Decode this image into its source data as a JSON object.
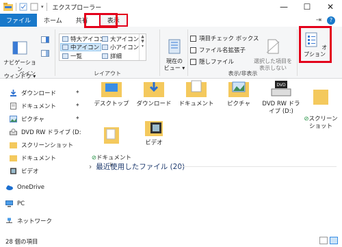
{
  "window": {
    "title": "エクスプローラー",
    "controls": {
      "minimize": "—",
      "maximize": "☐",
      "close": "✕"
    }
  },
  "tabs": {
    "file": "ファイル",
    "home": "ホーム",
    "share": "共有",
    "view": "表示",
    "expand_icon": "chevron-down-icon"
  },
  "ribbon": {
    "pane_group": {
      "label": "ペイン",
      "nav_pane": "ナビゲーション\nウィンドウ ▾"
    },
    "layout_group": {
      "label": "レイアウト",
      "items": [
        "特大アイコン",
        "大アイコン",
        "中アイコン",
        "小アイコン",
        "一覧",
        "詳細"
      ],
      "selected": "中アイコン"
    },
    "current_view": {
      "label": "現在の\nビュー ▾"
    },
    "showhide_group": {
      "label": "表示/非表示",
      "checks": [
        "項目チェック ボックス",
        "ファイル名拡張子",
        "隠しファイル"
      ],
      "hide_selected": "選択した項目を\n表示しない"
    },
    "options": {
      "label": "オプション"
    }
  },
  "nav": {
    "items": [
      "ダウンロード",
      "ドキュメント",
      "ピクチャ",
      "DVD RW ドライブ (D:",
      "スクリーンショット",
      "ドキュメント",
      "ビデオ",
      "OneDrive",
      "PC",
      "ネットワーク"
    ]
  },
  "content": {
    "row1": [
      "デスクトップ",
      "ダウンロード",
      "ドキュメント",
      "ピクチャ",
      "DVD RW ドライブ (D:)",
      "スクリーン\nショット"
    ],
    "row2": [
      "ドキュメント\nト",
      "ビデオ"
    ],
    "recent": "最近使用したファイル (20)"
  },
  "status": {
    "count": "28 個の項目"
  },
  "colors": {
    "accent": "#1979ca",
    "highlight": "#e3001b",
    "folder": "#f4c95d"
  }
}
